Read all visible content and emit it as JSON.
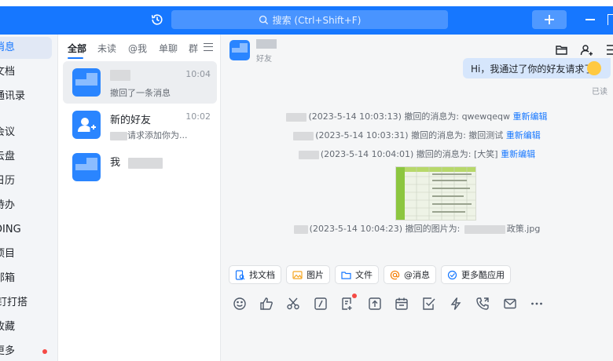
{
  "search": {
    "placeholder": "搜索 (Ctrl+Shift+F)"
  },
  "nav": {
    "items": [
      {
        "label": "消息",
        "active": true
      },
      {
        "label": "文档"
      },
      {
        "label": "通讯录"
      },
      {
        "label": "会议"
      },
      {
        "label": "云盘"
      },
      {
        "label": "日历"
      },
      {
        "label": "待办"
      },
      {
        "label": "DING"
      },
      {
        "label": "项目"
      },
      {
        "label": "邮箱"
      },
      {
        "label": "钉钉打搭"
      },
      {
        "label": "收藏"
      },
      {
        "label": "更多",
        "badge": true
      }
    ]
  },
  "list": {
    "tabs": [
      "全部",
      "未读",
      "@我",
      "单聊",
      "群"
    ],
    "conversations": [
      {
        "name": "",
        "message": "撤回了一条消息",
        "time": "10:04"
      },
      {
        "name": "新的好友",
        "message": "请求添加你为...",
        "time": "10:02"
      },
      {
        "name": "我",
        "message": "",
        "time": ""
      }
    ]
  },
  "chat": {
    "subtitle": "好友",
    "bubble": "Hi，我通过了你的好友请求了",
    "read": "已读",
    "system_lines": [
      {
        "text": "(2023-5-14 10:03:13) 撤回的消息为: qwewqeqw",
        "link": "重新编辑"
      },
      {
        "text": "(2023-5-14 10:03:31) 撤回的消息为: 撤回测试",
        "link": "重新编辑"
      },
      {
        "text": "(2023-5-14 10:04:01) 撤回的消息为: [大笑]",
        "link": "重新编辑"
      },
      {
        "text": "(2023-5-14 10:04:23) 撤回的图片为:",
        "suffix": "政策.jpg"
      }
    ],
    "quick": [
      "找文档",
      "图片",
      "文件",
      "@消息",
      "更多酷应用"
    ]
  },
  "colors": {
    "brand": "#1677ff",
    "badge": "#f54a45"
  }
}
